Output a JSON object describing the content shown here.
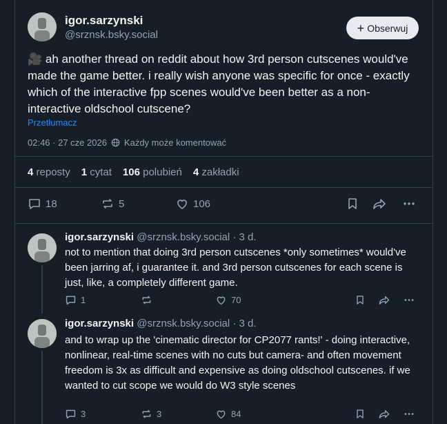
{
  "post": {
    "author_name": "igor.sarzynski",
    "author_handle": "@srznsk.bsky.social",
    "follow_label": "Obserwuj",
    "text": "🎥 ah another thread on reddit about how 3rd person cutscenes would've made the game better. i really wish anyone was specific for once - exactly which of the interactive fpp scenes would've been better as a non-interactive oldschool cutscene?",
    "translate_label": "Przetłumacz",
    "date": "02:46 · 27 cze 2026",
    "reply_setting": "Każdy może komentować",
    "counts": {
      "reposts_num": "4",
      "reposts_label": "reposty",
      "quotes_num": "1",
      "quotes_label": "cytat",
      "likes_num": "106",
      "likes_label": "polubień",
      "bookmarks_num": "4",
      "bookmarks_label": "zakładki"
    },
    "actions": {
      "replies": "18",
      "reposts": "5",
      "likes": "106"
    }
  },
  "replies": [
    {
      "name": "igor.sarzynski",
      "handle": "@srznsk.bsky.social · 3 d.",
      "text": "not to mention that doing 3rd person cutscenes *only sometimes* would've been jarring af, i guarantee it. and 3rd person cutscenes for each scene is just, like, a completely different game.",
      "replies": "1",
      "reposts": "",
      "likes": "70"
    },
    {
      "name": "igor.sarzynski",
      "handle": "@srznsk.bsky.social · 3 d.",
      "text": "and to wrap up the 'cinematic director for CP2077 rants!' - doing interactive, nonlinear, real-time scenes with no cuts but camera- and often movement freedom is 3x as difficult and expensive as doing oldschool cutscenes. if we wanted to cut scope we would do W3 style scenes",
      "replies": "3",
      "reposts": "3",
      "likes": "84"
    }
  ],
  "colors": {
    "background": "#161e27",
    "accent": "#208bfe",
    "muted": "#8fa3b6"
  }
}
